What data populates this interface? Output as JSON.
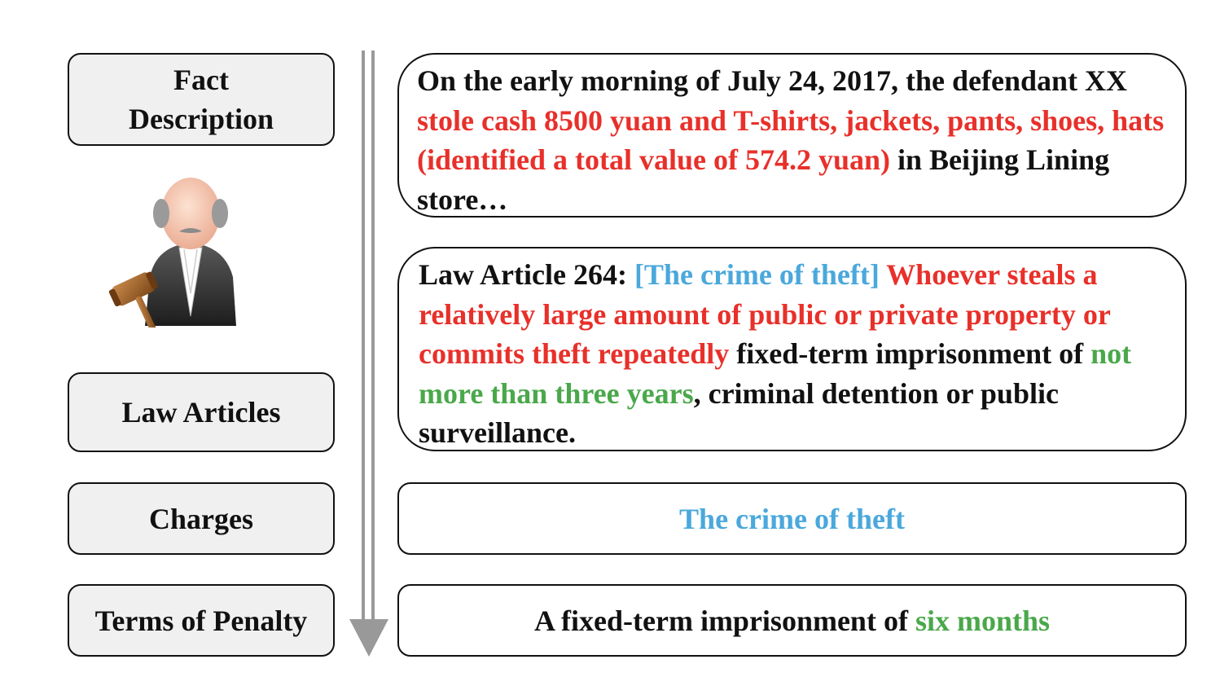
{
  "labels": {
    "fact_line1": "Fact",
    "fact_line2": "Description",
    "law_articles": "Law Articles",
    "charges": "Charges",
    "terms_of_penalty": "Terms of Penalty"
  },
  "fact_description": {
    "part1": "On the early morning of July 24, 2017, the defendant XX ",
    "part2_red": "stole cash 8500 yuan and T-shirts, jackets, pants, shoes, hats (identified a total value of 574.2 yuan)",
    "part3": " in Beijing Lining store…"
  },
  "law_article": {
    "prefix": "Law Article 264: ",
    "charge_blue": "[The crime of theft]",
    "space": " ",
    "condition_red": "Whoever steals a relatively large amount of public or private property or commits theft repeatedly",
    "middle": "  fixed-term imprisonment of ",
    "term_green": "not more than three years",
    "suffix": ", criminal detention or public surveillance."
  },
  "charges": {
    "value_blue": "The crime of theft"
  },
  "penalty": {
    "prefix": "A fixed-term imprisonment of ",
    "term_green": "six months"
  },
  "colors": {
    "red": "#e8302a",
    "blue": "#4aa8dc",
    "green": "#4aa84a",
    "label_bg": "#f0f0f0",
    "arrow": "#999999"
  },
  "icons": {
    "judge": "judge-with-gavel-icon",
    "arrow": "down-arrow-icon"
  }
}
